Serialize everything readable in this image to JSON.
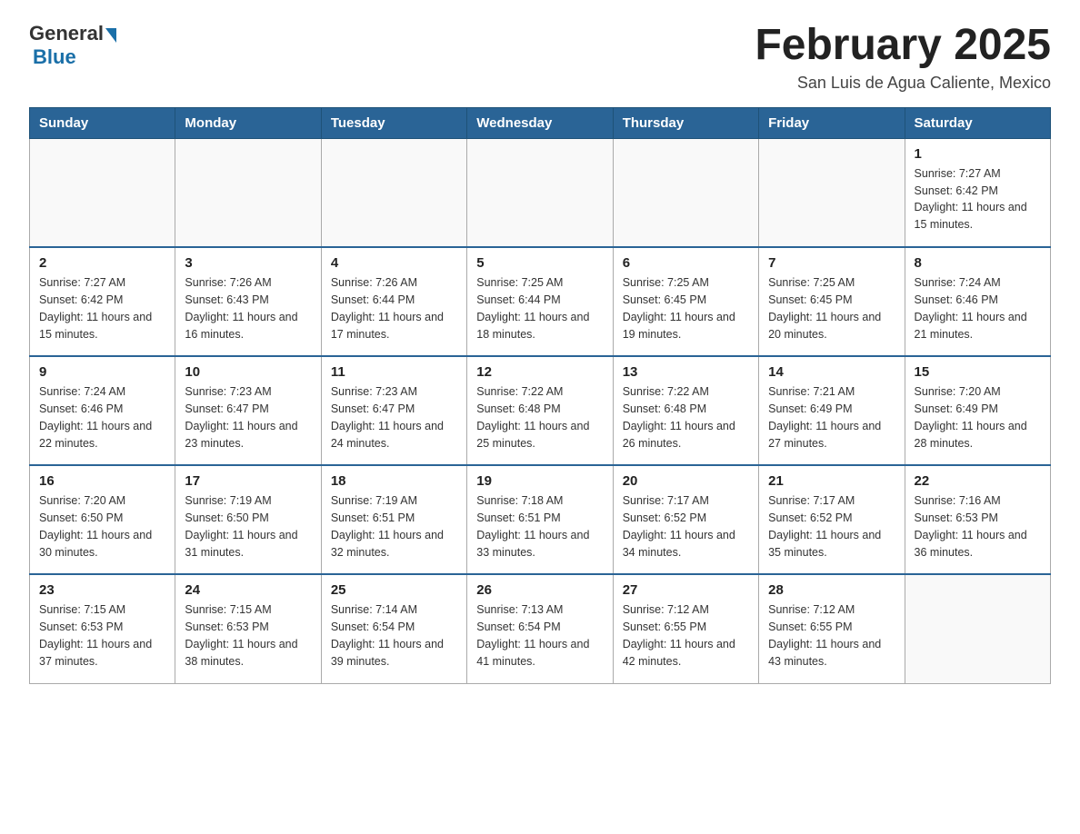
{
  "logo": {
    "general": "General",
    "blue": "Blue"
  },
  "title": "February 2025",
  "location": "San Luis de Agua Caliente, Mexico",
  "days_of_week": [
    "Sunday",
    "Monday",
    "Tuesday",
    "Wednesday",
    "Thursday",
    "Friday",
    "Saturday"
  ],
  "weeks": [
    [
      {
        "day": "",
        "info": ""
      },
      {
        "day": "",
        "info": ""
      },
      {
        "day": "",
        "info": ""
      },
      {
        "day": "",
        "info": ""
      },
      {
        "day": "",
        "info": ""
      },
      {
        "day": "",
        "info": ""
      },
      {
        "day": "1",
        "info": "Sunrise: 7:27 AM\nSunset: 6:42 PM\nDaylight: 11 hours and 15 minutes."
      }
    ],
    [
      {
        "day": "2",
        "info": "Sunrise: 7:27 AM\nSunset: 6:42 PM\nDaylight: 11 hours and 15 minutes."
      },
      {
        "day": "3",
        "info": "Sunrise: 7:26 AM\nSunset: 6:43 PM\nDaylight: 11 hours and 16 minutes."
      },
      {
        "day": "4",
        "info": "Sunrise: 7:26 AM\nSunset: 6:44 PM\nDaylight: 11 hours and 17 minutes."
      },
      {
        "day": "5",
        "info": "Sunrise: 7:25 AM\nSunset: 6:44 PM\nDaylight: 11 hours and 18 minutes."
      },
      {
        "day": "6",
        "info": "Sunrise: 7:25 AM\nSunset: 6:45 PM\nDaylight: 11 hours and 19 minutes."
      },
      {
        "day": "7",
        "info": "Sunrise: 7:25 AM\nSunset: 6:45 PM\nDaylight: 11 hours and 20 minutes."
      },
      {
        "day": "8",
        "info": "Sunrise: 7:24 AM\nSunset: 6:46 PM\nDaylight: 11 hours and 21 minutes."
      }
    ],
    [
      {
        "day": "9",
        "info": "Sunrise: 7:24 AM\nSunset: 6:46 PM\nDaylight: 11 hours and 22 minutes."
      },
      {
        "day": "10",
        "info": "Sunrise: 7:23 AM\nSunset: 6:47 PM\nDaylight: 11 hours and 23 minutes."
      },
      {
        "day": "11",
        "info": "Sunrise: 7:23 AM\nSunset: 6:47 PM\nDaylight: 11 hours and 24 minutes."
      },
      {
        "day": "12",
        "info": "Sunrise: 7:22 AM\nSunset: 6:48 PM\nDaylight: 11 hours and 25 minutes."
      },
      {
        "day": "13",
        "info": "Sunrise: 7:22 AM\nSunset: 6:48 PM\nDaylight: 11 hours and 26 minutes."
      },
      {
        "day": "14",
        "info": "Sunrise: 7:21 AM\nSunset: 6:49 PM\nDaylight: 11 hours and 27 minutes."
      },
      {
        "day": "15",
        "info": "Sunrise: 7:20 AM\nSunset: 6:49 PM\nDaylight: 11 hours and 28 minutes."
      }
    ],
    [
      {
        "day": "16",
        "info": "Sunrise: 7:20 AM\nSunset: 6:50 PM\nDaylight: 11 hours and 30 minutes."
      },
      {
        "day": "17",
        "info": "Sunrise: 7:19 AM\nSunset: 6:50 PM\nDaylight: 11 hours and 31 minutes."
      },
      {
        "day": "18",
        "info": "Sunrise: 7:19 AM\nSunset: 6:51 PM\nDaylight: 11 hours and 32 minutes."
      },
      {
        "day": "19",
        "info": "Sunrise: 7:18 AM\nSunset: 6:51 PM\nDaylight: 11 hours and 33 minutes."
      },
      {
        "day": "20",
        "info": "Sunrise: 7:17 AM\nSunset: 6:52 PM\nDaylight: 11 hours and 34 minutes."
      },
      {
        "day": "21",
        "info": "Sunrise: 7:17 AM\nSunset: 6:52 PM\nDaylight: 11 hours and 35 minutes."
      },
      {
        "day": "22",
        "info": "Sunrise: 7:16 AM\nSunset: 6:53 PM\nDaylight: 11 hours and 36 minutes."
      }
    ],
    [
      {
        "day": "23",
        "info": "Sunrise: 7:15 AM\nSunset: 6:53 PM\nDaylight: 11 hours and 37 minutes."
      },
      {
        "day": "24",
        "info": "Sunrise: 7:15 AM\nSunset: 6:53 PM\nDaylight: 11 hours and 38 minutes."
      },
      {
        "day": "25",
        "info": "Sunrise: 7:14 AM\nSunset: 6:54 PM\nDaylight: 11 hours and 39 minutes."
      },
      {
        "day": "26",
        "info": "Sunrise: 7:13 AM\nSunset: 6:54 PM\nDaylight: 11 hours and 41 minutes."
      },
      {
        "day": "27",
        "info": "Sunrise: 7:12 AM\nSunset: 6:55 PM\nDaylight: 11 hours and 42 minutes."
      },
      {
        "day": "28",
        "info": "Sunrise: 7:12 AM\nSunset: 6:55 PM\nDaylight: 11 hours and 43 minutes."
      },
      {
        "day": "",
        "info": ""
      }
    ]
  ]
}
